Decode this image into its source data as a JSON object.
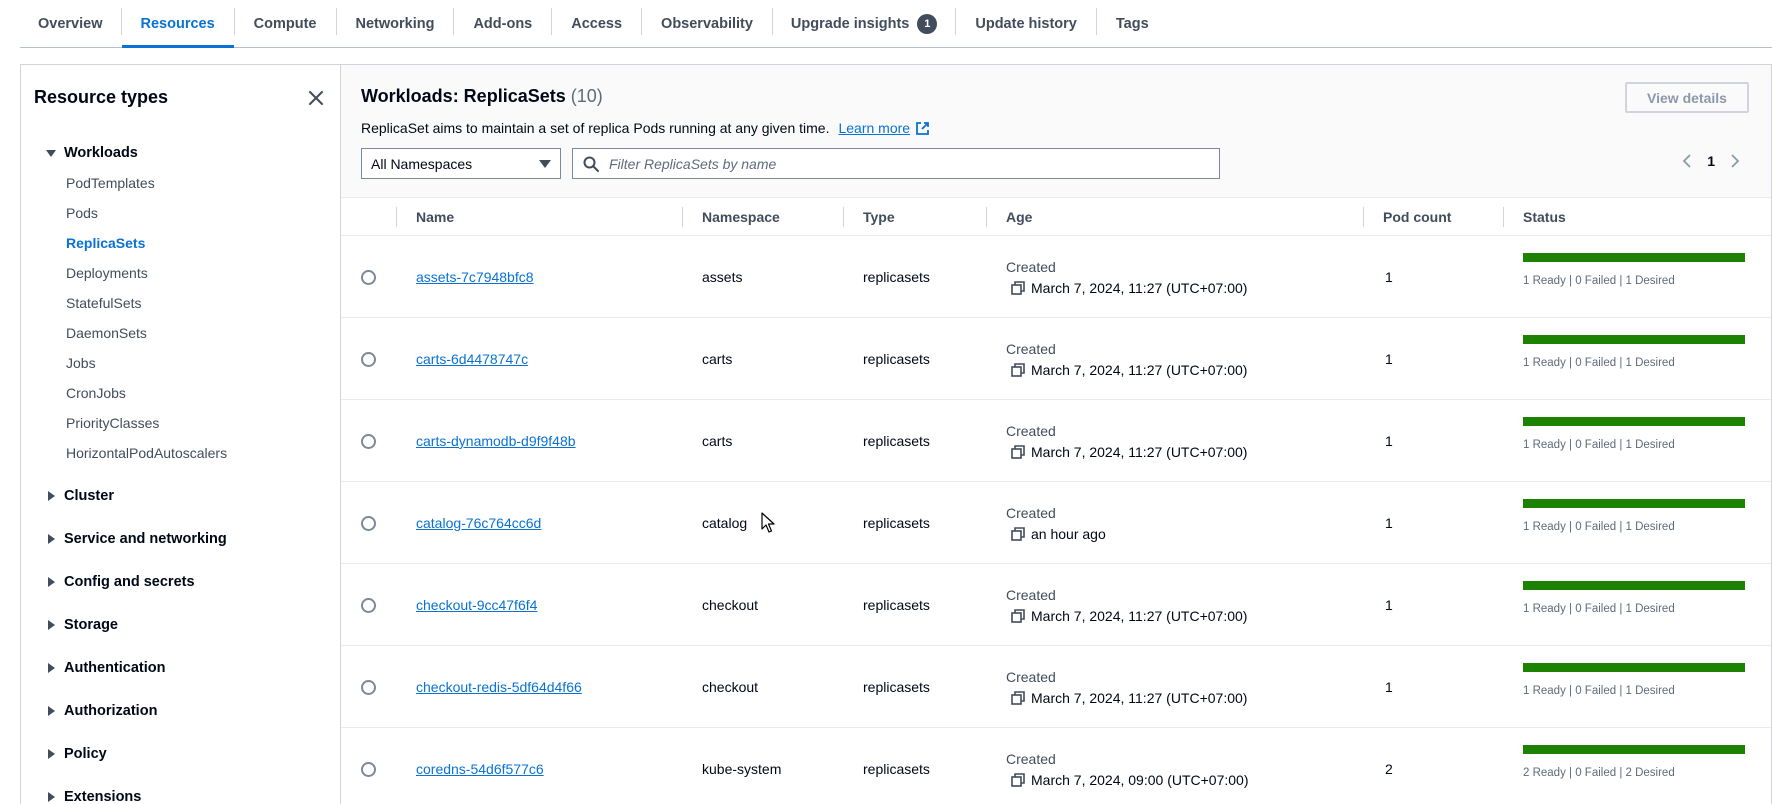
{
  "tabs": [
    {
      "label": "Overview",
      "active": false
    },
    {
      "label": "Resources",
      "active": true
    },
    {
      "label": "Compute",
      "active": false
    },
    {
      "label": "Networking",
      "active": false
    },
    {
      "label": "Add-ons",
      "active": false
    },
    {
      "label": "Access",
      "active": false
    },
    {
      "label": "Observability",
      "active": false
    },
    {
      "label": "Upgrade insights",
      "active": false,
      "badge": "1"
    },
    {
      "label": "Update history",
      "active": false
    },
    {
      "label": "Tags",
      "active": false
    }
  ],
  "sidebar": {
    "title": "Resource types",
    "workloads_label": "Workloads",
    "workload_items": [
      "PodTemplates",
      "Pods",
      "ReplicaSets",
      "Deployments",
      "StatefulSets",
      "DaemonSets",
      "Jobs",
      "CronJobs",
      "PriorityClasses",
      "HorizontalPodAutoscalers"
    ],
    "active_item": "ReplicaSets",
    "groups": [
      "Cluster",
      "Service and networking",
      "Config and secrets",
      "Storage",
      "Authentication",
      "Authorization",
      "Policy",
      "Extensions"
    ]
  },
  "main": {
    "title": "Workloads: ReplicaSets",
    "count": "(10)",
    "description": "ReplicaSet aims to maintain a set of replica Pods running at any given time.",
    "learn_more": "Learn more",
    "view_details": "View details",
    "namespace_select": "All Namespaces",
    "search_placeholder": "Filter ReplicaSets by name",
    "page": "1"
  },
  "table": {
    "columns": [
      "Name",
      "Namespace",
      "Type",
      "Age",
      "Pod count",
      "Status"
    ],
    "age_label": "Created",
    "rows": [
      {
        "name": "assets-7c7948bfc8",
        "namespace": "assets",
        "type": "replicasets",
        "age": "March 7, 2024, 11:27 (UTC+07:00)",
        "pods": "1",
        "status": "1 Ready | 0 Failed | 1 Desired",
        "ready_fraction": 1.0
      },
      {
        "name": "carts-6d4478747c",
        "namespace": "carts",
        "type": "replicasets",
        "age": "March 7, 2024, 11:27 (UTC+07:00)",
        "pods": "1",
        "status": "1 Ready | 0 Failed | 1 Desired",
        "ready_fraction": 1.0
      },
      {
        "name": "carts-dynamodb-d9f9f48b",
        "namespace": "carts",
        "type": "replicasets",
        "age": "March 7, 2024, 11:27 (UTC+07:00)",
        "pods": "1",
        "status": "1 Ready | 0 Failed | 1 Desired",
        "ready_fraction": 1.0
      },
      {
        "name": "catalog-76c764cc6d",
        "namespace": "catalog",
        "type": "replicasets",
        "age": "an hour ago",
        "pods": "1",
        "status": "1 Ready | 0 Failed | 1 Desired",
        "ready_fraction": 1.0
      },
      {
        "name": "checkout-9cc47f6f4",
        "namespace": "checkout",
        "type": "replicasets",
        "age": "March 7, 2024, 11:27 (UTC+07:00)",
        "pods": "1",
        "status": "1 Ready | 0 Failed | 1 Desired",
        "ready_fraction": 1.0
      },
      {
        "name": "checkout-redis-5df64d4f66",
        "namespace": "checkout",
        "type": "replicasets",
        "age": "March 7, 2024, 11:27 (UTC+07:00)",
        "pods": "1",
        "status": "1 Ready | 0 Failed | 1 Desired",
        "ready_fraction": 1.0
      },
      {
        "name": "coredns-54d6f577c6",
        "namespace": "kube-system",
        "type": "replicasets",
        "age": "March 7, 2024, 09:00 (UTC+07:00)",
        "pods": "2",
        "status": "2 Ready | 0 Failed | 2 Desired",
        "ready_fraction": 1.0
      }
    ]
  },
  "colors": {
    "accent": "#0972d3",
    "success": "#1d8102",
    "text": "#000716",
    "muted": "#414d5c"
  }
}
